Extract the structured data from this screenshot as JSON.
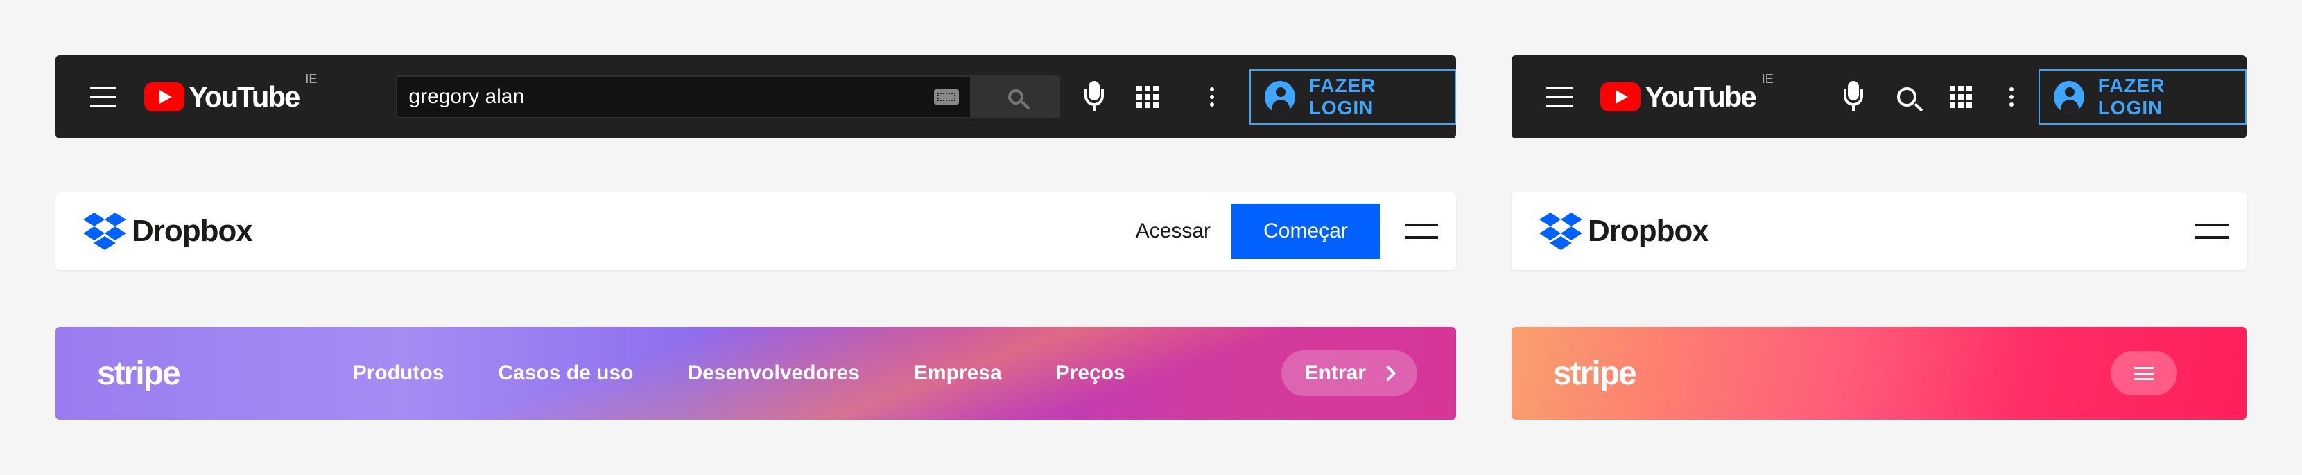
{
  "youtube": {
    "logo_text": "YouTube",
    "region": "IE",
    "search_value": "gregory alan",
    "login_label": "FAZER LOGIN",
    "colors": {
      "bg": "#212121",
      "accent": "#3ea6ff",
      "brand": "#ff0000"
    },
    "icons": [
      "menu-icon",
      "youtube-logo",
      "keyboard-icon",
      "search-icon",
      "mic-icon",
      "apps-icon",
      "more-icon",
      "account-icon"
    ]
  },
  "dropbox": {
    "logo_text": "Dropbox",
    "signin_label": "Acessar",
    "cta_label": "Começar",
    "colors": {
      "brand": "#0061fe"
    },
    "icons": [
      "dropbox-logo-icon",
      "menu-icon"
    ]
  },
  "stripe": {
    "logo_text": "stripe",
    "nav": [
      "Produtos",
      "Casos de uso",
      "Desenvolvedores",
      "Empresa",
      "Preços"
    ],
    "signin_label": "Entrar",
    "icons": [
      "chevron-right-icon",
      "menu-icon"
    ]
  }
}
